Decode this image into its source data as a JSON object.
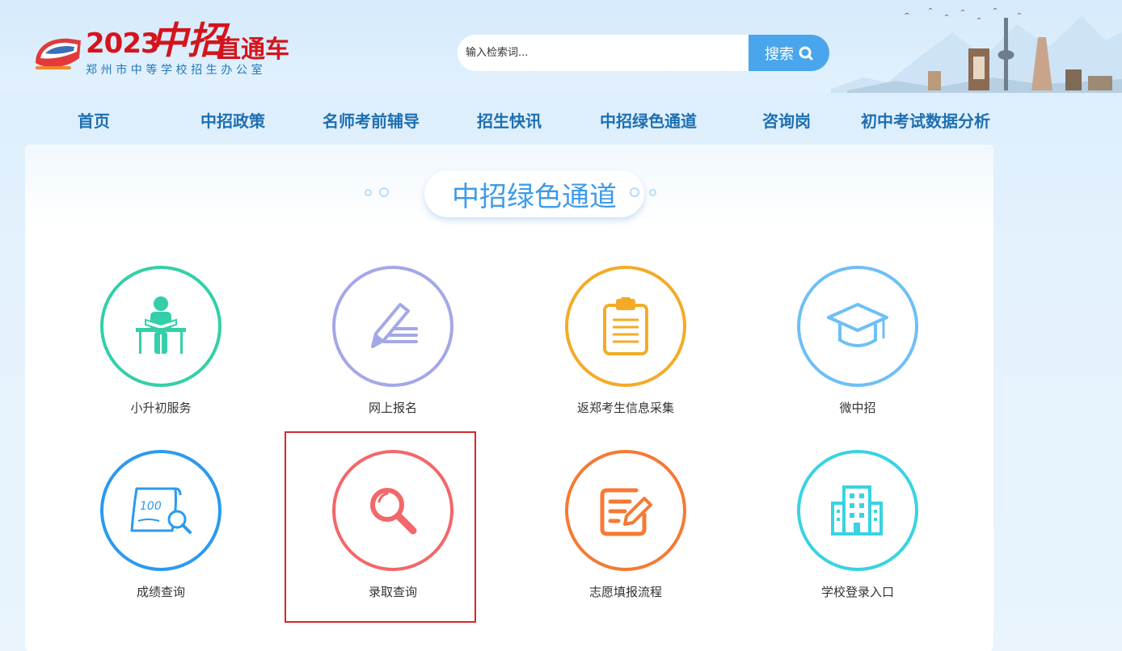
{
  "header": {
    "logo_year": "2023",
    "logo_zhongzhao": "中招",
    "logo_rest": "直通车",
    "logo_subtitle": "郑州市中等学校招生办公室",
    "search_placeholder": "输入检索词...",
    "search_button": "搜索"
  },
  "nav": {
    "items": [
      "首页",
      "中招政策",
      "名师考前辅导",
      "招生快讯",
      "中招绿色通道",
      "咨询岗",
      "初中考试数据分析"
    ]
  },
  "section": {
    "title": "中招绿色通道"
  },
  "tiles": [
    {
      "label": "小升初服务",
      "icon": "student-desk-icon",
      "color": "#34cfa8"
    },
    {
      "label": "网上报名",
      "icon": "pen-writing-icon",
      "color": "#a3a8e6"
    },
    {
      "label": "返郑考生信息采集",
      "icon": "clipboard-icon",
      "color": "#f3ab27"
    },
    {
      "label": "微中招",
      "icon": "graduation-cap-icon",
      "color": "#6fbff5"
    },
    {
      "label": "成绩查询",
      "icon": "score-search-icon",
      "color": "#2b9af0"
    },
    {
      "label": "录取查询",
      "icon": "magnifier-icon",
      "color": "#f2676a"
    },
    {
      "label": "志愿填报流程",
      "icon": "form-edit-icon",
      "color": "#f57a33"
    },
    {
      "label": "学校登录入口",
      "icon": "building-icon",
      "color": "#39d3e2"
    }
  ],
  "colors": {
    "brand_red": "#d4141c",
    "nav_blue": "#1d6fb2",
    "accent_blue": "#4aa6ec",
    "highlight_red": "#d9252e"
  }
}
